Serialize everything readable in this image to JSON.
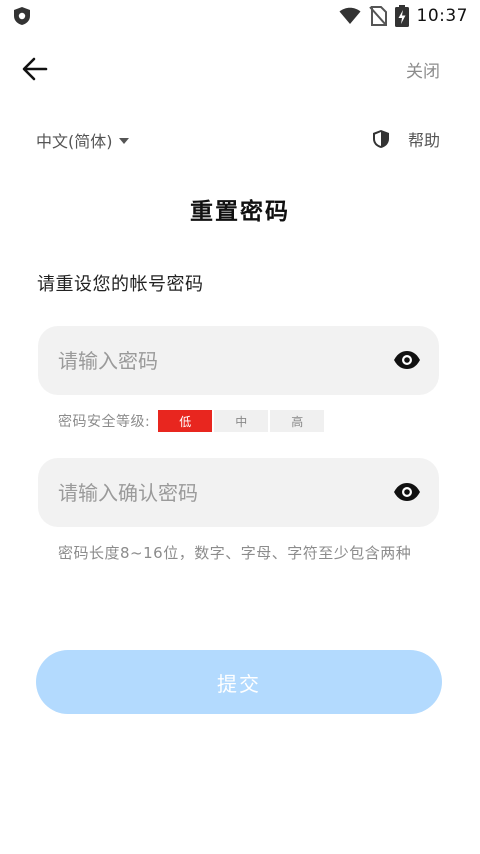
{
  "status_bar": {
    "time": "10:37",
    "icons": [
      "shield-status-icon",
      "wifi-icon",
      "no-sim-icon",
      "battery-charging-icon"
    ]
  },
  "top_bar": {
    "back_icon": "arrow-left-icon",
    "close_label": "关闭"
  },
  "language": {
    "selected": "中文(简体)",
    "help_label": "帮助",
    "help_icon": "shield-icon"
  },
  "title": "重置密码",
  "subtitle": "请重设您的帐号密码",
  "password_field": {
    "placeholder": "请输入密码",
    "value": ""
  },
  "strength": {
    "label": "密码安全等级:",
    "levels": [
      "低",
      "中",
      "高"
    ],
    "active_index": 0,
    "active_color": "#e8261f"
  },
  "confirm_field": {
    "placeholder": "请输入确认密码",
    "value": ""
  },
  "hint": "密码长度8~16位，数字、字母、字符至少包含两种",
  "submit_label": "提交",
  "colors": {
    "submit_bg": "#b3dafe",
    "input_bg": "#f2f2f2"
  }
}
